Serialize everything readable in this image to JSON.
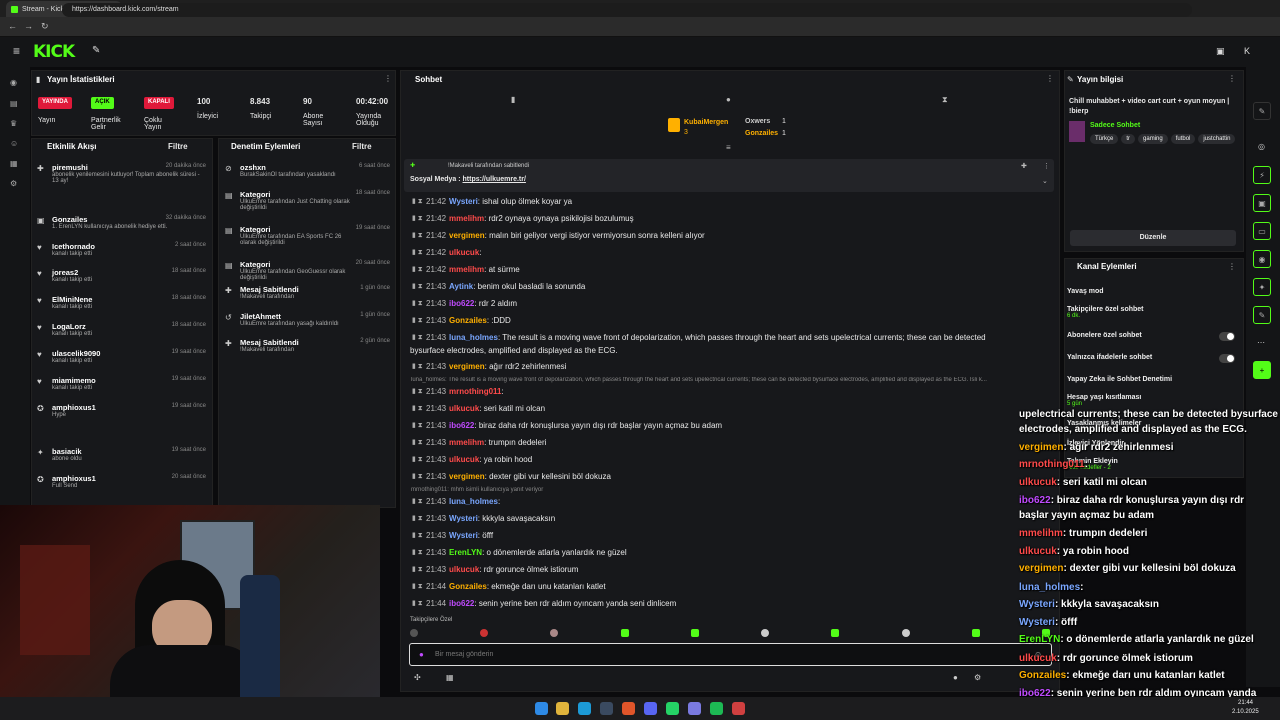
{
  "browser": {
    "tab_title": "Stream - Kick Dashboard",
    "url": "https://dashboard.kick.com/stream"
  },
  "brand": {
    "logo": "KICK",
    "accent": "#53fc18"
  },
  "stats": {
    "title": "Yayın İstatistikleri",
    "status": [
      {
        "badge": "YAYINDA",
        "label": "Yayın"
      },
      {
        "badge": "AÇIK",
        "label": "Partnerlik Gelir"
      },
      {
        "badge": "KAPALI",
        "label": "Çoklu Yayın"
      }
    ],
    "metrics": [
      {
        "value": "100",
        "label": "İzleyici"
      },
      {
        "value": "8.843",
        "label": "Takipçi"
      },
      {
        "value": "90",
        "label": "Abone Sayısı"
      },
      {
        "value": "00:42:00",
        "label": "Yayında Olduğu"
      }
    ]
  },
  "activity": {
    "title": "Etkinlik Akışı",
    "filter": "Filtre",
    "items": [
      {
        "name": "piremushi",
        "sub": "abonelik yenilemesini kutluyor! Toplam abonelik süresi - 13 ay!",
        "time": "20 dakika önce"
      },
      {
        "name": "Gonzailes",
        "sub": "1. ErenLYN kullanıcıya abonelik hediye etti.",
        "time": "32 dakika önce"
      },
      {
        "name": "Icethornado",
        "sub": "kanalı takip etti",
        "time": "2 saat önce"
      },
      {
        "name": "joreas2",
        "sub": "kanalı takip etti",
        "time": "18 saat önce"
      },
      {
        "name": "ElMiniNene",
        "sub": "kanalı takip etti",
        "time": "18 saat önce"
      },
      {
        "name": "LogaLorz",
        "sub": "kanalı takip etti",
        "time": "18 saat önce"
      },
      {
        "name": "ulascelik9090",
        "sub": "kanalı takip etti",
        "time": "19 saat önce"
      },
      {
        "name": "miamimemo",
        "sub": "kanalı takip etti",
        "time": "19 saat önce"
      },
      {
        "name": "amphioxus1",
        "sub": "Hype",
        "time": "19 saat önce"
      },
      {
        "name": "basiacik",
        "sub": "abone oldu",
        "time": "19 saat önce"
      },
      {
        "name": "amphioxus1",
        "sub": "Full Send",
        "time": "20 saat önce"
      }
    ]
  },
  "moderation": {
    "title": "Denetim Eylemleri",
    "filter": "Filtre",
    "items": [
      {
        "name": "ozshxn",
        "sub": "BurakSakinOl tarafından yasaklandı",
        "time": "6 saat önce"
      },
      {
        "name": "Kategori",
        "sub": "UlkuEmre tarafından Just Chatting olarak değiştirildi",
        "time": "18 saat önce"
      },
      {
        "name": "Kategori",
        "sub": "UlkuEmre tarafından EA Sports FC 26 olarak değiştirildi",
        "time": "19 saat önce"
      },
      {
        "name": "Kategori",
        "sub": "UlkuEmre tarafından GeoGuessr olarak değiştirildi",
        "time": "20 saat önce"
      },
      {
        "name": "Mesaj Sabitlendi",
        "sub": "!Makaveli tarafından",
        "time": "1 gün önce"
      },
      {
        "name": "JiletAhmett",
        "sub": "UlkuEmre tarafından yasağı kaldırıldı",
        "time": "1 gün önce"
      },
      {
        "name": "Mesaj Sabitlendi",
        "sub": "!Makaveli tarafından",
        "time": "2 gün önce"
      }
    ]
  },
  "chat": {
    "title": "Sohbet",
    "top_gifters": [
      {
        "name": "KubaiMergen",
        "count": "3"
      },
      {
        "name": "Oxwers",
        "count": "1"
      },
      {
        "name": "Gonzailes",
        "count": "1"
      }
    ],
    "pinned": {
      "by": "!Makaveli tarafından sabitlendi",
      "text": "Sosyal Medya : ",
      "link": "https://ulkuemre.tr/"
    },
    "messages": [
      {
        "time": "21:42",
        "user": "Wysteri",
        "color": "#7aa7ff",
        "text": "ishal olup ölmek koyar ya"
      },
      {
        "time": "21:42",
        "user": "mmelihm",
        "color": "#ff4b4b",
        "text": "rdr2 oynaya oynaya psikilojisi bozulumuş"
      },
      {
        "time": "21:42",
        "user": "vergimen",
        "color": "#ffb000",
        "text": "malın biri geliyor vergi istiyor vermiyorsun sonra kelleni alıyor"
      },
      {
        "time": "21:42",
        "user": "ulkucuk",
        "color": "#ff4b4b",
        "text": ""
      },
      {
        "time": "21:42",
        "user": "mmelihm",
        "color": "#ff4b4b",
        "text": "at sürme"
      },
      {
        "time": "21:43",
        "user": "Aytink",
        "color": "#7aa7ff",
        "text": "benim okul basladi la sonunda"
      },
      {
        "time": "21:43",
        "user": "ibo622",
        "color": "#c04bff",
        "text": "rdr 2 aldım"
      },
      {
        "time": "21:43",
        "user": "Gonzailes",
        "color": "#ffb000",
        "text": ":DDD"
      },
      {
        "time": "21:43",
        "user": "luna_holmes",
        "color": "#7aa7ff",
        "text": "The result is a moving wave front of depolarization, which passes through the heart and sets upelectrical currents; these can be detected"
      },
      {
        "time": "21:43",
        "user": "vergimen",
        "color": "#ffb000",
        "text": "ağır rdr2 zehirlenmesi"
      },
      {
        "time": "21:43",
        "user": "mrnothing011",
        "color": "#ff4b4b",
        "text": ""
      },
      {
        "time": "21:43",
        "user": "ulkucuk",
        "color": "#ff4b4b",
        "text": "seri katil mi olcan"
      },
      {
        "time": "21:43",
        "user": "ibo622",
        "color": "#c04bff",
        "text": "biraz daha rdr konuşlursa yayın dışı rdr başlar yayın açmaz bu adam"
      },
      {
        "time": "21:43",
        "user": "mmelihm",
        "color": "#ff4b4b",
        "text": "trumpın dedeleri"
      },
      {
        "time": "21:43",
        "user": "ulkucuk",
        "color": "#ff4b4b",
        "text": "ya robin hood"
      },
      {
        "time": "21:43",
        "user": "vergimen",
        "color": "#ffb000",
        "text": "dexter gibi vur kellesini böl dokuza"
      },
      {
        "time": "21:43",
        "user": "luna_holmes",
        "color": "#7aa7ff",
        "text": ""
      },
      {
        "time": "21:43",
        "user": "Wysteri",
        "color": "#7aa7ff",
        "text": "kkkyla savaşacaksın"
      },
      {
        "time": "21:43",
        "user": "Wysteri",
        "color": "#7aa7ff",
        "text": "öfff"
      },
      {
        "time": "21:43",
        "user": "ErenLYN",
        "color": "#53fc18",
        "text": "o dönemlerde atlarla yanlardık ne güzel"
      },
      {
        "time": "21:43",
        "user": "ulkucuk",
        "color": "#ff4b4b",
        "text": "rdr gorunce ölmek istiorum"
      },
      {
        "time": "21:44",
        "user": "Gonzailes",
        "color": "#ffb000",
        "text": "ekmeğe darı unu katanları katlet"
      },
      {
        "time": "21:44",
        "user": "ibo622",
        "color": "#c04bff",
        "text": "senin yerine ben rdr aldım oyıncam yanda seni dinlicem"
      }
    ],
    "continuation": "bysurface electrodes, amplified and displayed as the ECG.",
    "reply1": "luna_holmes: The result is a moving wave front of depolarization, which passes through the heart and sets upelectrical currents; these can be detected bysurface electrodes, amplified and displayed as the ECG. İsli k...",
    "reply2": "mrnothing011: mhm isimli kullanıcıya yanıt veriyor",
    "followers_label": "Takipçilere Özel",
    "input_placeholder": "Bir mesaj gönderin"
  },
  "stream_info": {
    "title": "Yayın bilgisi",
    "stream_title": "Chill muhabbet + video cart curt + oyun moyun | !bierp",
    "category": "Sadece Sohbet",
    "tags": [
      "Türkçe",
      "tr",
      "gaming",
      "futbol",
      "justchattin"
    ],
    "edit": "Düzenle"
  },
  "channel_actions": {
    "title": "Kanal Eylemleri",
    "items": [
      {
        "label": "Yavaş mod",
        "sub": ""
      },
      {
        "label": "Takipçilere özel sohbet",
        "sub": "6 dk."
      },
      {
        "label": "Abonelere özel sohbet",
        "sub": ""
      },
      {
        "label": "Yalnızca ifadelerle sohbet",
        "sub": ""
      },
      {
        "label": "Yapay Zeka ile Sohbet Denetimi",
        "sub": ""
      },
      {
        "label": "Hesap yaşı kısıtlaması",
        "sub": "5 gün"
      },
      {
        "label": "Yasaklanmış kelimeler",
        "sub": ""
      },
      {
        "label": "İzleyici Yönlendir",
        "sub": ""
      },
      {
        "label": "Tahmin Ekleyin",
        "sub": "Aktif hedefler - 2"
      }
    ]
  },
  "overlay": [
    {
      "user": "",
      "text": "upelectrical currents; these can be detected bysurface"
    },
    {
      "user": "",
      "text": "electrodes, amplified and displayed as the ECG."
    },
    {
      "user": "vergimen",
      "text": ": ağır rdr2 zehirlenmesi"
    },
    {
      "user": "mrnothing011",
      "text": ":"
    },
    {
      "user": "ulkucuk",
      "text": ": seri katil mi olcan"
    },
    {
      "user": "ibo622",
      "text": ": biraz daha rdr konuşlursa yayın dışı rdr"
    },
    {
      "user": "",
      "text": "başlar yayın açmaz bu adam"
    },
    {
      "user": "mmelihm",
      "text": ": trumpın dedeleri"
    },
    {
      "user": "ulkucuk",
      "text": ": ya robin hood"
    },
    {
      "user": "vergimen",
      "text": ": dexter gibi vur kellesini böl dokuza"
    },
    {
      "user": "luna_holmes",
      "text": ":"
    },
    {
      "user": "Wysteri",
      "text": ": kkkyla savaşacaksın"
    },
    {
      "user": "Wysteri",
      "text": ": öfff"
    },
    {
      "user": "ErenLYN",
      "text": ": o dönemlerde atlarla yanlardık ne güzel"
    },
    {
      "user": "ulkucuk",
      "text": ": rdr gorunce ölmek istiorum"
    },
    {
      "user": "Gonzailes",
      "text": ": ekmeğe darı unu katanları katlet"
    },
    {
      "user": "ibo622",
      "text": ": senin yerine ben rdr aldım oyıncam yanda"
    },
    {
      "user": "",
      "text": "seni dinlicem"
    }
  ],
  "taskbar": {
    "time": "21:44",
    "date": "2.10.2025"
  }
}
